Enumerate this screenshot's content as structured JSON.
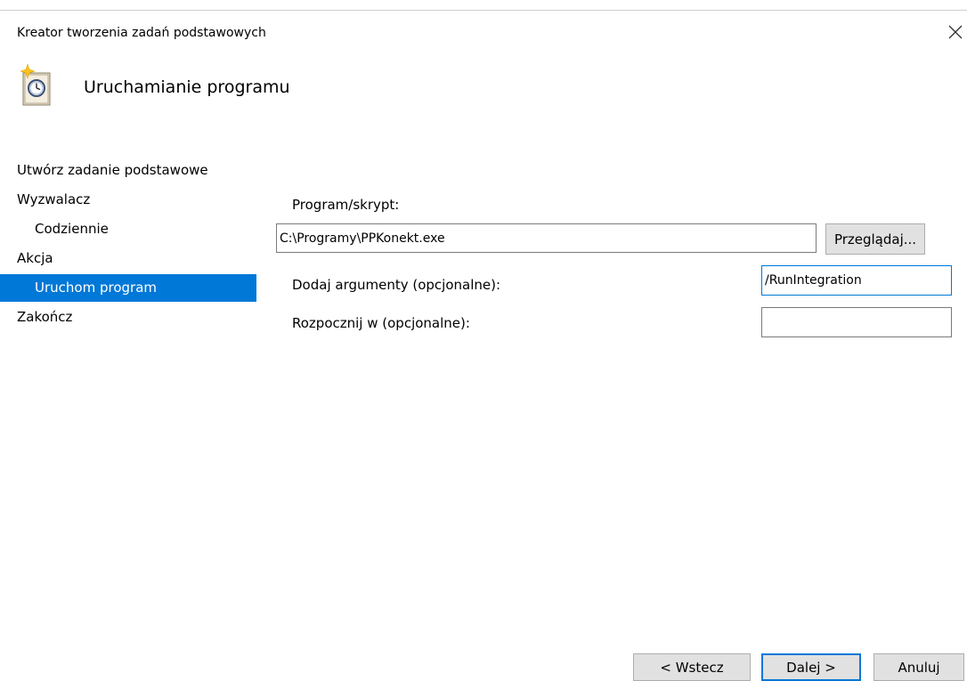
{
  "window": {
    "title": "Kreator tworzenia zadań podstawowych",
    "close_icon": "close-icon"
  },
  "header": {
    "icon": "task-scheduler-clock-icon",
    "title": "Uruchamianie programu"
  },
  "sidebar": {
    "items": [
      {
        "label": "Utwórz zadanie podstawowe"
      },
      {
        "label": "Wyzwalacz"
      },
      {
        "label": "Codziennie"
      },
      {
        "label": "Akcja"
      },
      {
        "label": "Uruchom program"
      },
      {
        "label": "Zakończ"
      }
    ],
    "selected": "Uruchom program",
    "selected_color": "#0078d7"
  },
  "form": {
    "program": {
      "label": "Program/skrypt:",
      "value": "C:\\Programy\\PPKonekt.exe",
      "browse_label": "Przeglądaj..."
    },
    "arguments": {
      "label": "Dodaj argumenty (opcjonalne):",
      "value": "/RunIntegration"
    },
    "start_in": {
      "label": "Rozpocznij w (opcjonalne):",
      "value": ""
    }
  },
  "footer": {
    "back_label": "< Wstecz",
    "next_label": "Dalej >",
    "cancel_label": "Anuluj"
  },
  "colors": {
    "accent": "#0078d7",
    "button_face": "#e1e1e1",
    "border": "#7a7a7a"
  }
}
